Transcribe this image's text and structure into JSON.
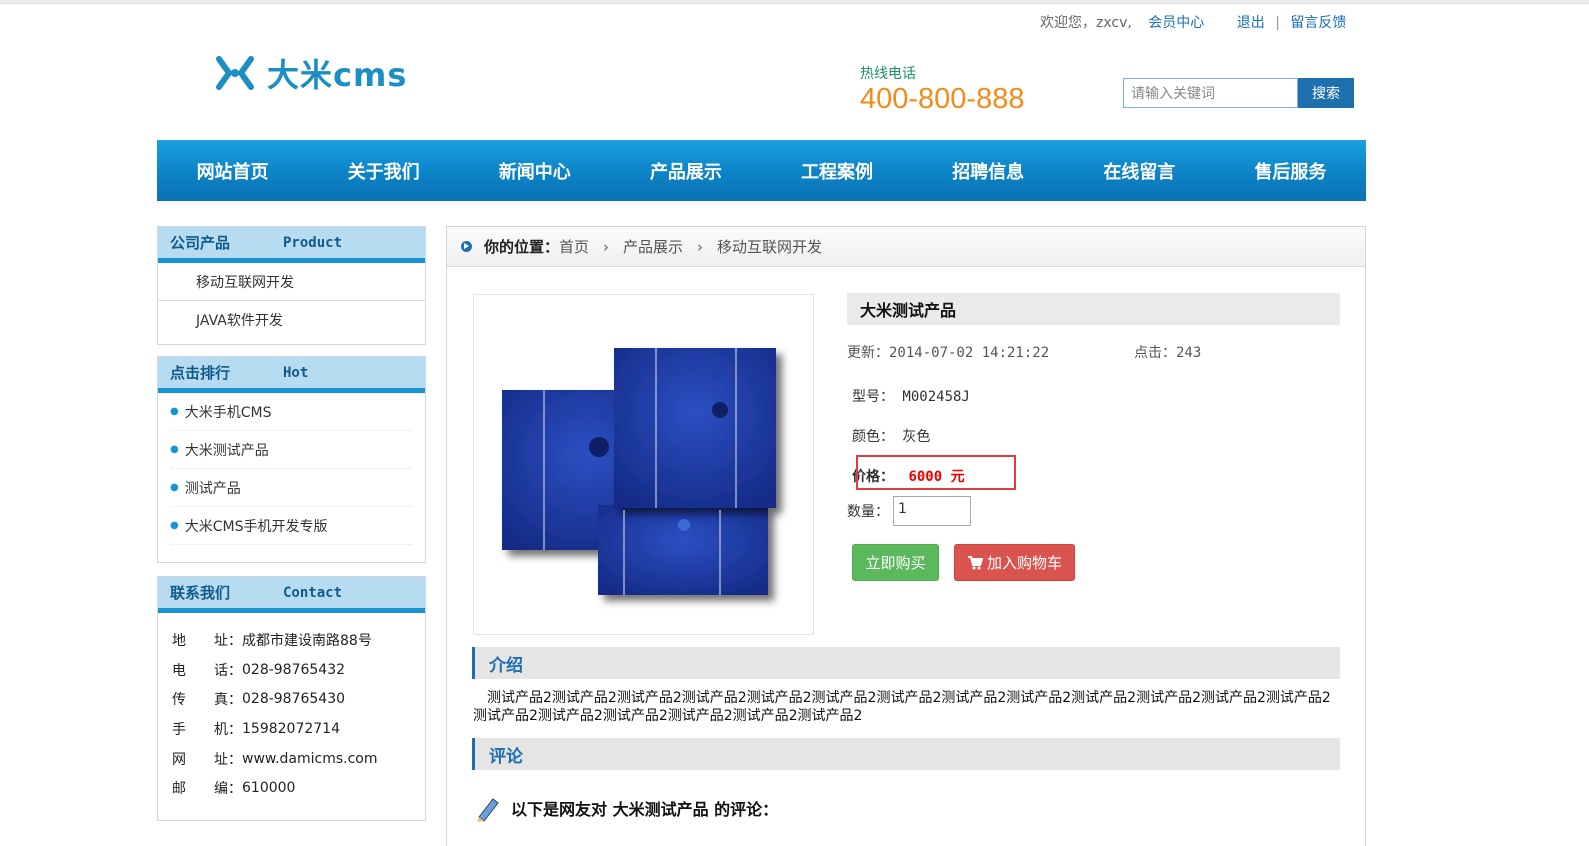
{
  "topbar": {
    "welcome": "欢迎您，zxcv,",
    "member_center": "会员中心",
    "logout": "退出",
    "separator": "|",
    "feedback": "留言反馈"
  },
  "logo": {
    "text": "大米cms",
    "color": "#1b8fc4"
  },
  "hotline": {
    "label": "热线电话",
    "number": "400-800-888",
    "color": "#f28b1a"
  },
  "search": {
    "placeholder": "请输入关键词",
    "button": "搜索"
  },
  "nav": [
    "网站首页",
    "关于我们",
    "新闻中心",
    "产品展示",
    "工程案例",
    "招聘信息",
    "在线留言",
    "售后服务"
  ],
  "sidebar": {
    "products": {
      "title": "公司产品",
      "title_en": "Product",
      "items": [
        "移动互联网开发",
        "JAVA软件开发"
      ]
    },
    "hot": {
      "title": "点击排行",
      "title_en": "Hot",
      "items": [
        "大米手机CMS",
        "大米测试产品",
        "测试产品",
        "大米CMS手机开发专版"
      ]
    },
    "contact": {
      "title": "联系我们",
      "title_en": "Contact",
      "rows": [
        {
          "k": "地　　址：",
          "v": "成都市建设南路88号"
        },
        {
          "k": "电　　话：",
          "v": "028-98765432"
        },
        {
          "k": "传　　真：",
          "v": "028-98765430"
        },
        {
          "k": "手　　机：",
          "v": "15982072714"
        },
        {
          "k": "网　　址：",
          "v": "www.damicms.com"
        },
        {
          "k": "邮　　编：",
          "v": "610000"
        }
      ]
    }
  },
  "breadcrumb": {
    "label": "你的位置：",
    "items": [
      "首页",
      "产品展示",
      "移动互联网开发"
    ],
    "arrow": "›"
  },
  "product": {
    "title": "大米测试产品",
    "updated": "更新：2014-07-02 14:21:22",
    "clicks": "点击：243",
    "model": "型号： M002458J",
    "color_text": "颜色： 灰色",
    "price_label": "价格：",
    "price_value": "6000 元",
    "qty_label": "数量：",
    "qty_value": "1",
    "buy_button": "立即购买",
    "cart_button": "加入购物车"
  },
  "intro": {
    "title": "介绍",
    "text": "测试产品2测试产品2测试产品2测试产品2测试产品2测试产品2测试产品2测试产品2测试产品2测试产品2测试产品2测试产品2测试产品2测试产品2测试产品2测试产品2测试产品2测试产品2测试产品2"
  },
  "comments": {
    "title": "评论",
    "heading": "以下是网友对 大米测试产品 的评论："
  },
  "colors": {
    "nav": "#0c83c6",
    "accent": "#1795d3",
    "price": "#e00000",
    "buy": "#5cb85c",
    "cart": "#d9534f"
  }
}
